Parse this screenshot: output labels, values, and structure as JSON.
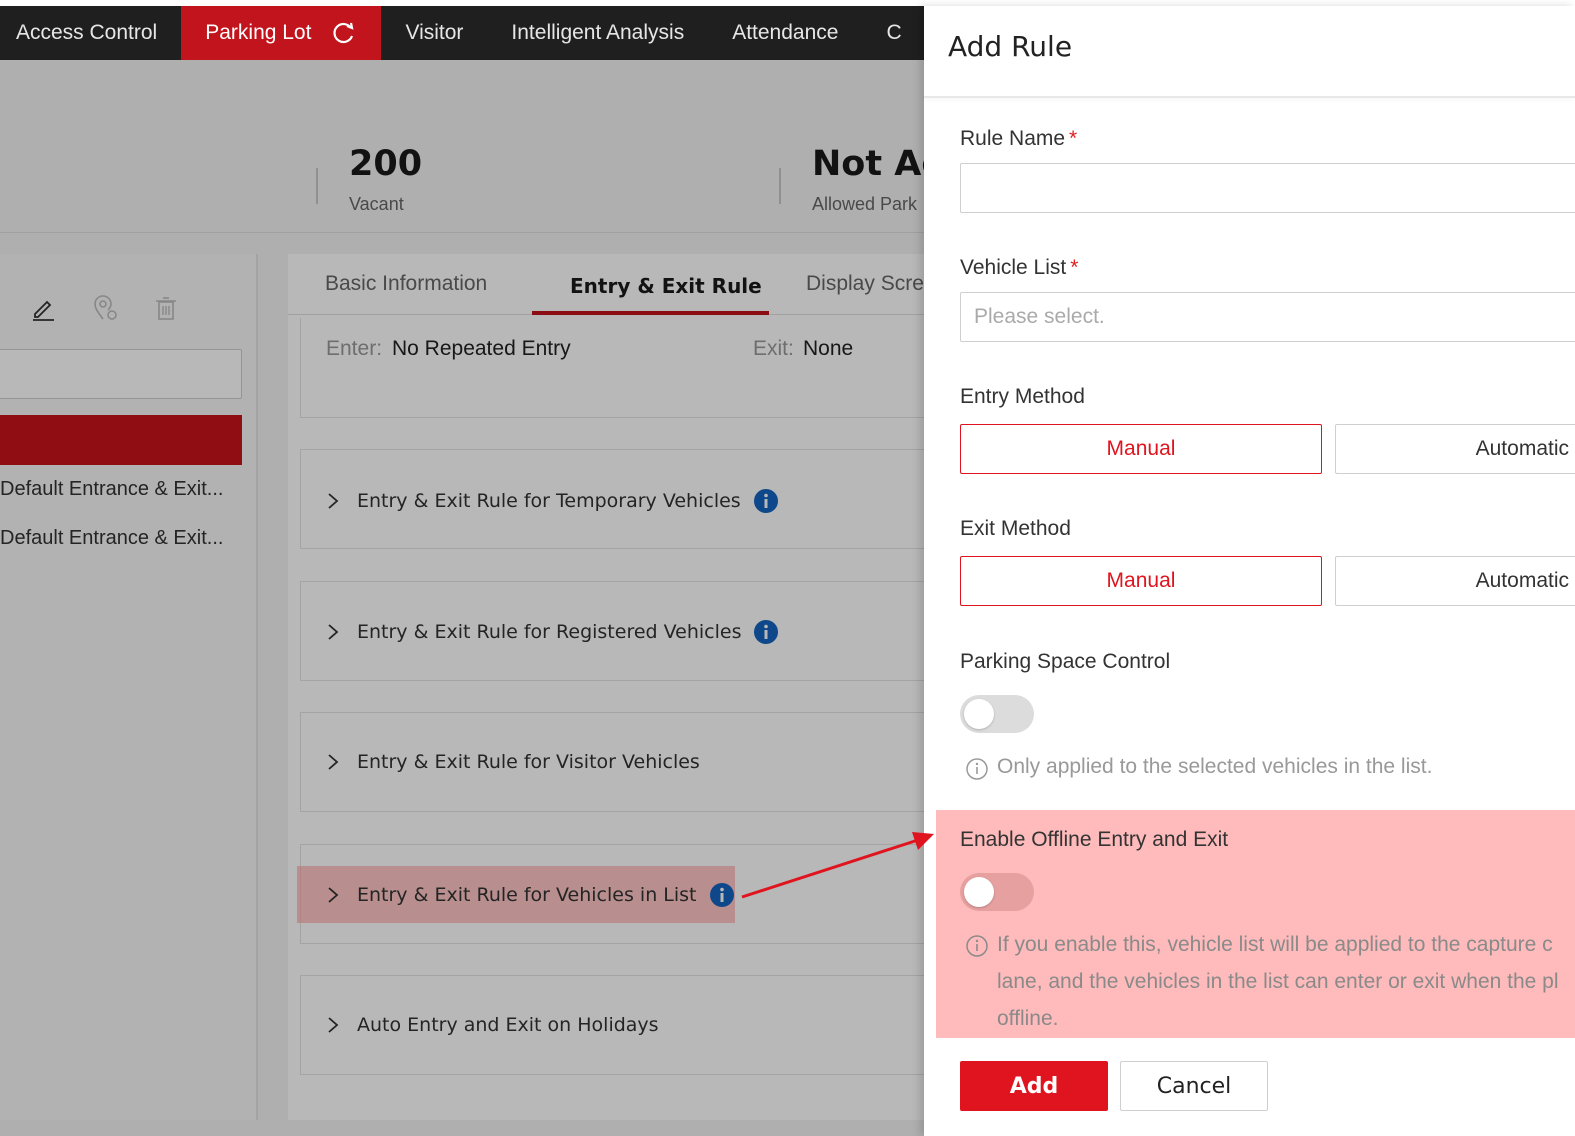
{
  "nav": {
    "items": [
      {
        "label": "Access Control",
        "active": false
      },
      {
        "label": "Parking Lot",
        "active": true
      },
      {
        "label": "Visitor",
        "active": false
      },
      {
        "label": "Intelligent Analysis",
        "active": false
      },
      {
        "label": "Attendance",
        "active": false
      },
      {
        "label": "C",
        "active": false
      }
    ]
  },
  "stats": {
    "vacant_value": "200",
    "vacant_label": "Vacant",
    "second_value": "Not Ac",
    "second_label": "Allowed Park"
  },
  "left_panel": {
    "items": [
      "Default Entrance & Exit...",
      "Default Entrance & Exit..."
    ]
  },
  "tabs": [
    "Basic Information",
    "Entry & Exit Rule",
    "Display Scre"
  ],
  "summary": {
    "enter_key": "Enter:",
    "enter_value": "No Repeated Entry",
    "exit_key": "Exit:",
    "exit_value": "None"
  },
  "rules": [
    "Entry & Exit Rule for Temporary Vehicles",
    "Entry & Exit Rule for Registered Vehicles",
    "Entry & Exit Rule for Visitor Vehicles",
    "Entry & Exit Rule for Vehicles in List",
    "Auto Entry and Exit on Holidays"
  ],
  "drawer": {
    "title": "Add Rule",
    "rule_name_label": "Rule Name",
    "rule_name_value": "",
    "vehicle_list_label": "Vehicle List",
    "vehicle_list_placeholder": "Please select.",
    "required_mark": "*",
    "entry_method_label": "Entry Method",
    "exit_method_label": "Exit Method",
    "method_manual": "Manual",
    "method_automatic": "Automatic",
    "entry_method_selected": "Manual",
    "exit_method_selected": "Manual",
    "parking_space_label": "Parking Space Control",
    "parking_space_enabled": false,
    "parking_space_hint": "Only applied to the selected vehicles in the list.",
    "offline_label": "Enable Offline Entry and Exit",
    "offline_enabled": false,
    "offline_hint_lines": [
      "If you enable this, vehicle list will be applied to the capture c",
      "lane, and the vehicles in the list can enter or exit when the pl",
      "offline."
    ],
    "add_button": "Add",
    "cancel_button": "Cancel"
  },
  "colors": {
    "accent": "#e0141e",
    "nav_bg": "#1f1f1f",
    "info_blue": "#1565c0",
    "highlight": "#ffb3b3"
  }
}
